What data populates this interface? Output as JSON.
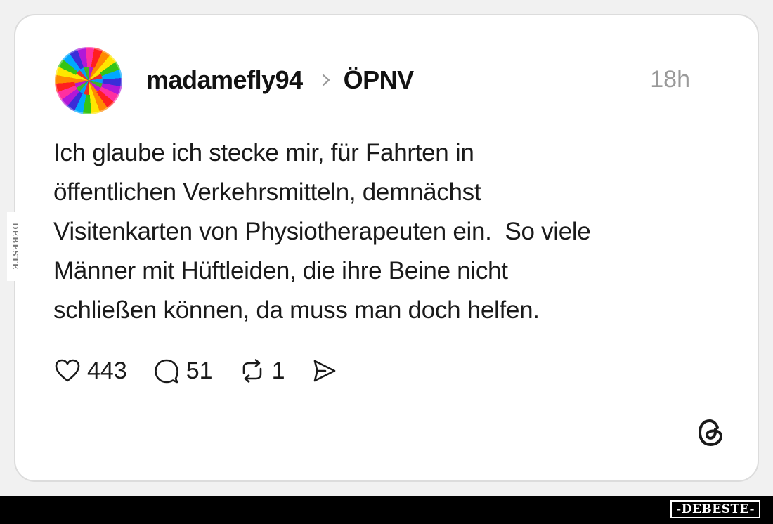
{
  "post": {
    "username": "madamefly94",
    "topic": "ÖPNV",
    "time": "18h",
    "text_lines": [
      "Ich glaube ich stecke mir, für Fahrten in",
      "öffentlichen Verkehrsmitteln, demnächst",
      "Visitenkarten von Physiotherapeuten ein.  So viele",
      "Männer mit Hüftleiden, die ihre Beine nicht",
      "schließen können, da muss man doch helfen."
    ],
    "likes": "443",
    "replies": "51",
    "reposts": "1"
  },
  "icons": {
    "like": "heart-icon",
    "reply": "comment-icon",
    "repost": "repost-icon",
    "share": "send-icon",
    "chevron": "chevron-right-icon",
    "brand": "threads-logo-icon"
  },
  "watermark": {
    "side": "DEBESTE",
    "footer": "-DEBESTE-"
  },
  "colors": {
    "text": "#1a1a1a",
    "muted": "#9a9a9a",
    "card": "#ffffff",
    "background": "#f1f1f1"
  }
}
